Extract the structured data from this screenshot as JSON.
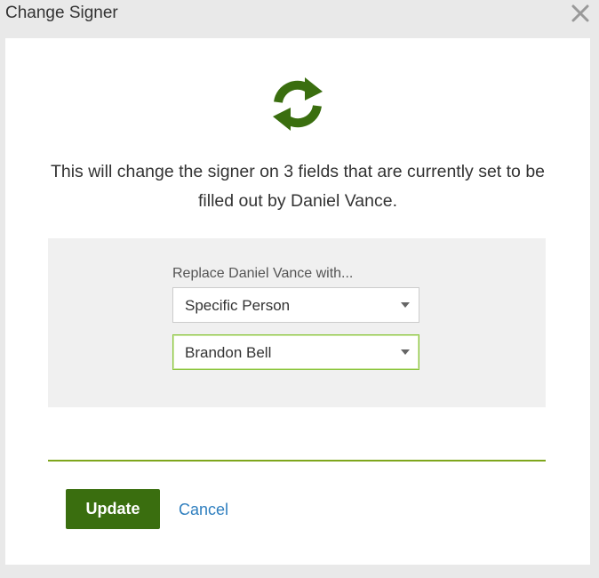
{
  "dialog": {
    "title": "Change Signer"
  },
  "message": "This will change the signer on 3 fields that are currently set to be filled out by Daniel Vance.",
  "replace": {
    "label": "Replace Daniel Vance with...",
    "type_select": {
      "value": "Specific Person"
    },
    "person_select": {
      "value": "Brandon Bell"
    }
  },
  "actions": {
    "update_label": "Update",
    "cancel_label": "Cancel"
  },
  "colors": {
    "icon_green": "#3a6e0f",
    "button_green": "#3a6e0f",
    "rule_green": "#7fa61c",
    "link_blue": "#2f7fbf"
  },
  "icons": {
    "header": "sync-icon",
    "close": "close-icon"
  }
}
